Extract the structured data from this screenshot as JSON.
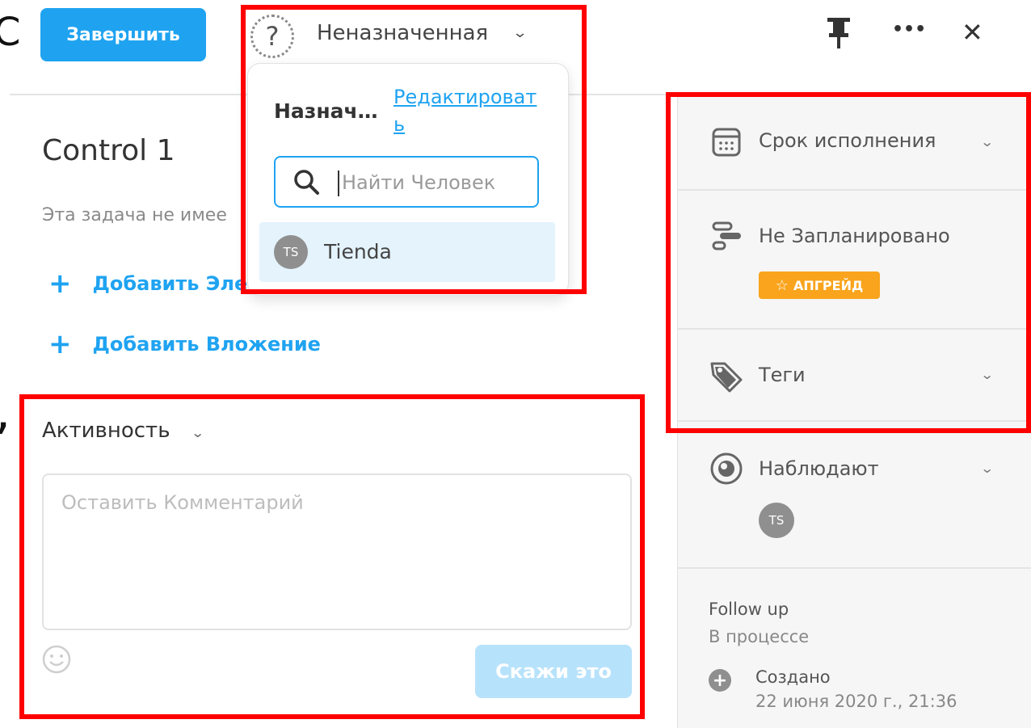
{
  "header": {
    "complete_label": "Завершить",
    "assignee_label": "Неназначенная",
    "assignee_chevron": "⌄",
    "icons": [
      "pin-icon",
      "more-icon",
      "close-icon"
    ],
    "more_glyph": "•••",
    "close_glyph": "✕"
  },
  "assign_dropdown": {
    "title": "Назнач…",
    "edit_link": "Редактировать",
    "search_placeholder": "Найти Человек",
    "people": [
      {
        "initials": "TS",
        "name": "Tienda"
      }
    ]
  },
  "task": {
    "title": "Control 1",
    "description": "Эта задача не имее",
    "add_item_label": "Добавить Эле",
    "add_attachment_label": "Добавить Вложение"
  },
  "activity": {
    "title": "Активность",
    "comment_placeholder": "Оставить Комментарий",
    "submit_label": "Скажи это"
  },
  "sidebar": {
    "due_date_label": "Срок исполнения",
    "schedule_label": "Не Запланировано",
    "upgrade_label": "АПГРЕЙД",
    "tags_label": "Теги",
    "watchers_label": "Наблюдают",
    "watcher_initials": "TS",
    "status_title": "Follow up",
    "status_value": "В процессе",
    "created_label": "Создано",
    "created_date": "22 июня 2020 г., 21:36"
  },
  "colors": {
    "accent": "#1fa3f1",
    "upgrade": "#f9a41c",
    "annotation": "#ff0000"
  }
}
